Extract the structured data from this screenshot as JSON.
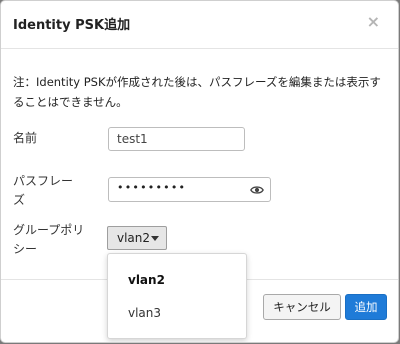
{
  "dialog": {
    "title": "Identity PSK追加",
    "close_label": "×",
    "note": "注：Identity PSKが作成された後は、パスフレーズを編集または表示することはできません。"
  },
  "form": {
    "name": {
      "label": "名前",
      "value": "test1"
    },
    "passphrase": {
      "label": "パスフレーズ",
      "masked_value": "•••••••••",
      "toggle_icon": "eye-icon"
    },
    "group_policy": {
      "label": "グループポリシー",
      "selected": "vlan2",
      "options": [
        "vlan2",
        "vlan3"
      ]
    }
  },
  "footer": {
    "cancel_label": "キャンセル",
    "add_label": "追加"
  },
  "colors": {
    "primary_button": "#1f7bd8",
    "backdrop": "#7a7a7a"
  }
}
